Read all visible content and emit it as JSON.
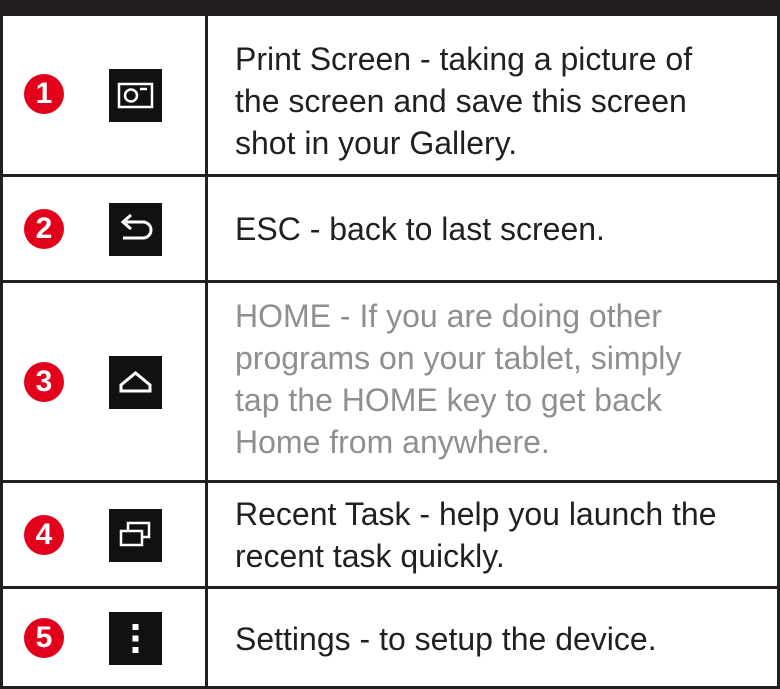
{
  "keys": [
    {
      "number": "1",
      "icon": "screenshot-icon",
      "description": "Print Screen - taking a picture of\nthe screen and save this screen\nshot in your Gallery."
    },
    {
      "number": "2",
      "icon": "back-icon",
      "description": "ESC - back to last screen."
    },
    {
      "number": "3",
      "icon": "home-icon",
      "description": "HOME - If you are doing other\nprograms on your tablet, simply\ntap the HOME key to get back\nHome from anywhere."
    },
    {
      "number": "4",
      "icon": "recent-tasks-icon",
      "description": "Recent Task - help you launch the\nrecent task quickly."
    },
    {
      "number": "5",
      "icon": "menu-icon",
      "description": "Settings - to setup the device."
    }
  ],
  "colors": {
    "badge": "#e3001b",
    "border": "#231f20",
    "text": "#231f20",
    "dim_text": "#8f8f8f",
    "icon_bg": "#111111"
  }
}
